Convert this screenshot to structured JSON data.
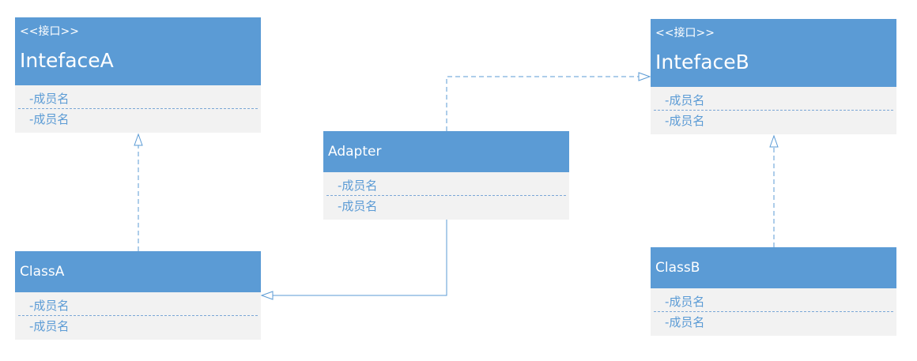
{
  "diagram": {
    "colors": {
      "header_fill": "#5b9bd5",
      "body_fill": "#f2f2f2",
      "member_text": "#5b9bd5",
      "connector": "#5b9bd5"
    },
    "interface_a": {
      "stereotype": "<<接口>>",
      "name": "IntefaceA",
      "members": [
        "-成员名",
        "-成员名"
      ]
    },
    "interface_b": {
      "stereotype": "<<接口>>",
      "name": "IntefaceB",
      "members": [
        "-成员名",
        "-成员名"
      ]
    },
    "adapter": {
      "name": "Adapter",
      "members": [
        "-成员名",
        "-成员名"
      ]
    },
    "class_a": {
      "name": "ClassA",
      "members": [
        "-成员名",
        "-成员名"
      ]
    },
    "class_b": {
      "name": "ClassB",
      "members": [
        "-成员名",
        "-成员名"
      ]
    }
  }
}
